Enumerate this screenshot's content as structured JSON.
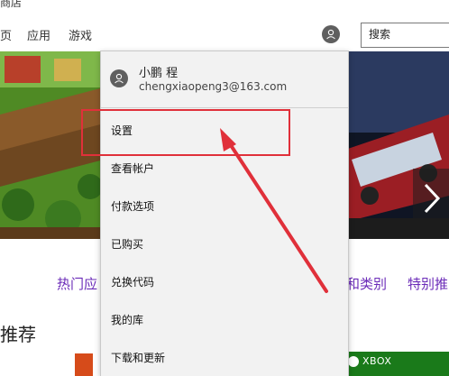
{
  "header": {
    "title_fragment": "商店",
    "nav": [
      {
        "label": "页"
      },
      {
        "label": "应用"
      },
      {
        "label": "游戏"
      }
    ],
    "search": {
      "placeholder": "搜索",
      "value": ""
    }
  },
  "account_menu": {
    "user_name": "小鹏 程",
    "email": "chengxiaopeng3@163.com",
    "items": [
      {
        "label": "设置"
      },
      {
        "label": "查看帐户"
      },
      {
        "label": "付款选项"
      },
      {
        "label": "已购买"
      },
      {
        "label": "兑换代码"
      },
      {
        "label": "我的库"
      },
      {
        "label": "下载和更新"
      }
    ]
  },
  "categories": [
    {
      "label": "热门应"
    },
    {
      "label": "和类别"
    },
    {
      "label": "特别推"
    }
  ],
  "section_title": "推荐",
  "tiles": {
    "xbox_label": "XBOX"
  },
  "colors": {
    "accent_purple": "#6b2bb8",
    "annotation_red": "#e0303a",
    "xbox_green": "#1a7a1a"
  }
}
